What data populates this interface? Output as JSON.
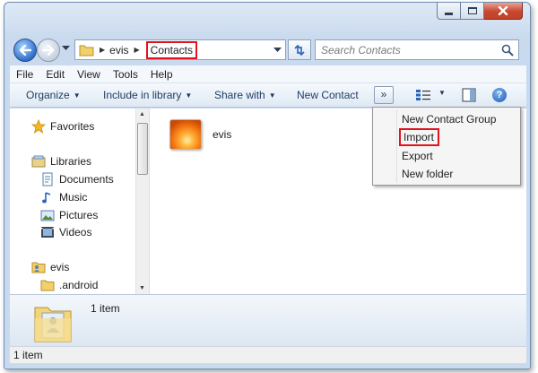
{
  "address": {
    "crumbs": [
      "evis",
      "Contacts"
    ],
    "search_placeholder": "Search Contacts"
  },
  "menubar": [
    "File",
    "Edit",
    "View",
    "Tools",
    "Help"
  ],
  "commandbar": {
    "organize": "Organize",
    "include_in_library": "Include in library",
    "share_with": "Share with",
    "new_contact": "New Contact",
    "overflow": "»"
  },
  "nav": {
    "favorites": "Favorites",
    "libraries": "Libraries",
    "documents": "Documents",
    "music": "Music",
    "pictures": "Pictures",
    "videos": "Videos",
    "evis": "evis",
    "android": ".android"
  },
  "content": {
    "items": [
      {
        "label": "evis"
      }
    ]
  },
  "popup": {
    "items": [
      "New Contact Group",
      "Import",
      "Export",
      "New folder"
    ]
  },
  "details": {
    "count": "1 item"
  },
  "status": {
    "count": "1 item"
  },
  "colors": {
    "highlight": "#e0141e",
    "accent": "#1e3a5f"
  }
}
